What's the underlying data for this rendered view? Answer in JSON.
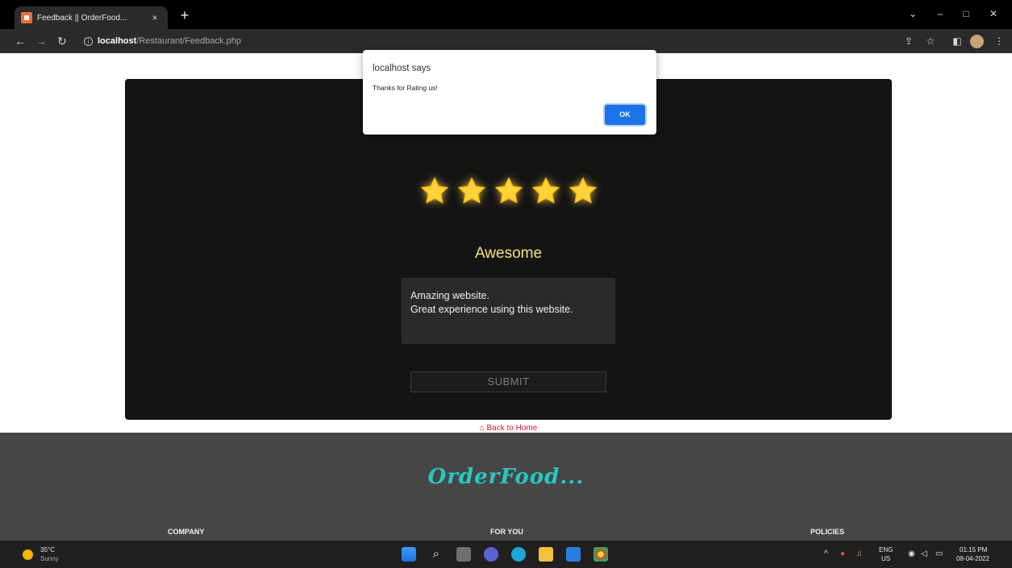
{
  "browser": {
    "tab_title": "Feedback || OrderFood...",
    "tab_close": "×",
    "new_tab": "+",
    "url_host": "localhost",
    "url_path": "/Restaurant/Feedback.php",
    "window_controls": {
      "minimize": "–",
      "maximize": "□",
      "close": "✕",
      "tab_search": "⌄"
    }
  },
  "dialog": {
    "title": "localhost says",
    "message": "Thanks for Rating us!",
    "ok_label": "OK"
  },
  "feedback": {
    "stars_selected": 5,
    "stars_total": 5,
    "star_color": "#ffd43b",
    "rating_label": "Awesome",
    "comment_line1": "Amazing website.",
    "comment_line2": "Great experience using this website.",
    "submit_label": "SUBMIT",
    "back_link": "Back to Home",
    "back_link_color": "#d11a2a"
  },
  "footer": {
    "logo": "OrderFood...",
    "logo_color": "#27c8c2",
    "columns": [
      "COMPANY",
      "FOR YOU",
      "POLICIES"
    ]
  },
  "taskbar": {
    "temperature": "35°C",
    "condition": "Sunny",
    "language_top": "ENG",
    "language_bottom": "US",
    "time": "01:15 PM",
    "date": "08-04-2022"
  }
}
